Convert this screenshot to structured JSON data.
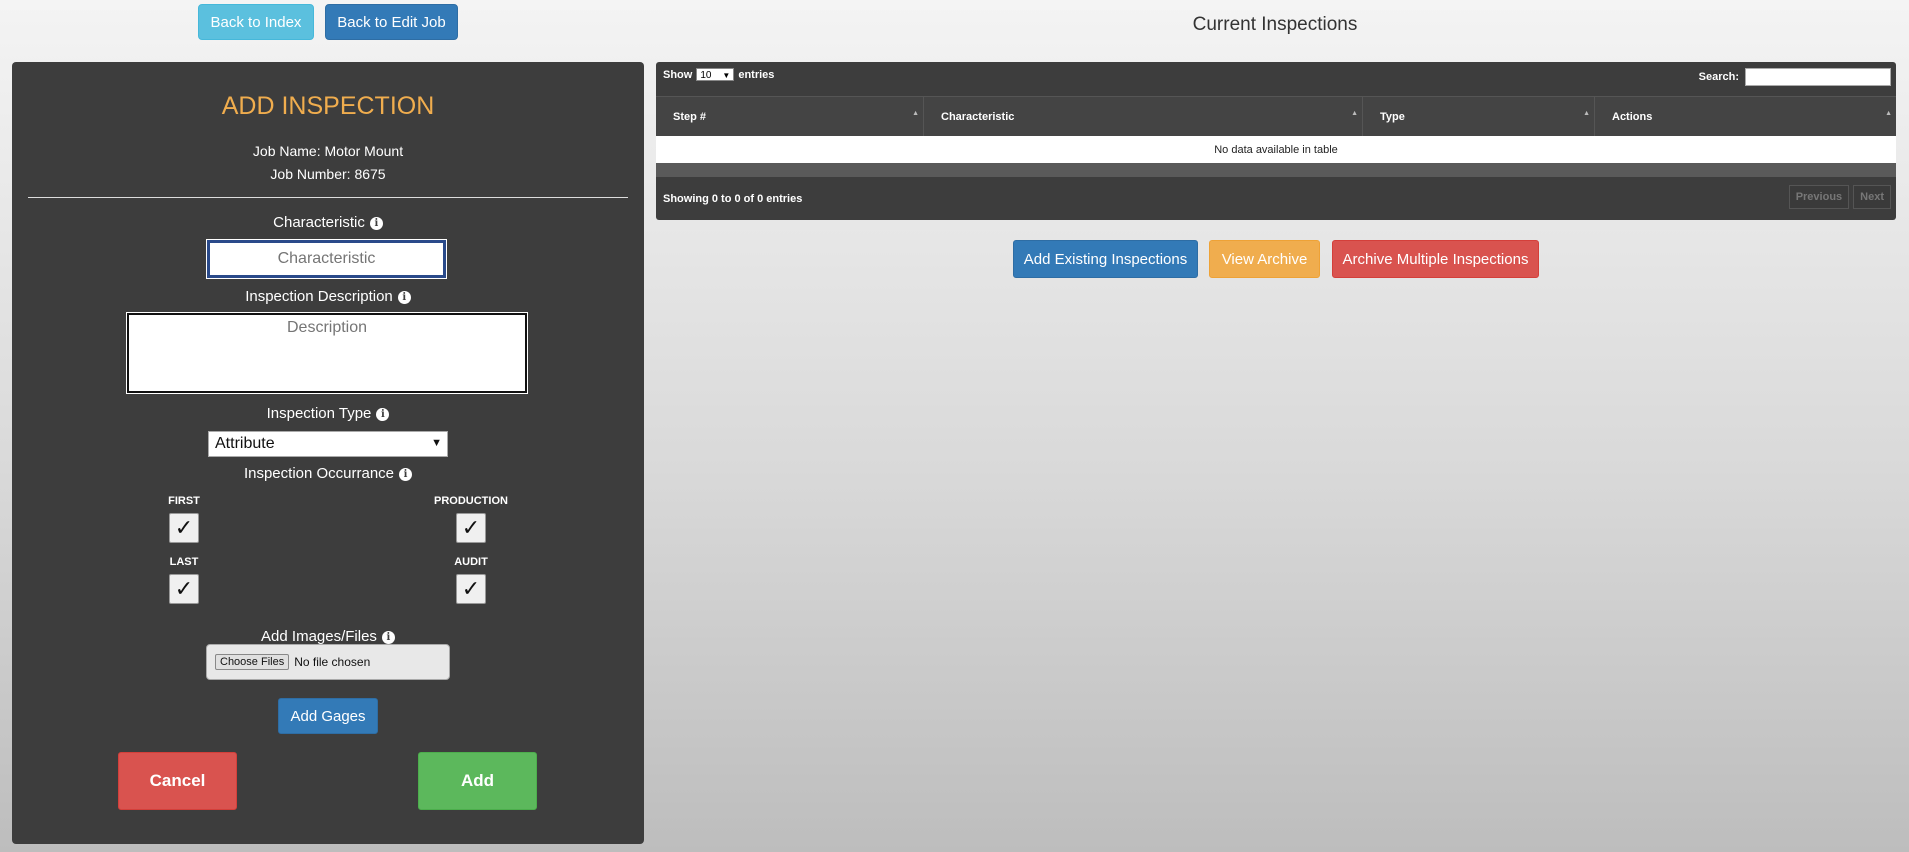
{
  "top_nav": {
    "back_index": "Back to Index",
    "back_edit_job": "Back to Edit Job"
  },
  "page_heading": "Current Inspections",
  "form": {
    "title": "ADD INSPECTION",
    "job_name": "Job Name: Motor Mount",
    "job_number": "Job Number: 8675",
    "characteristic_label": "Characteristic",
    "characteristic_placeholder": "Characteristic",
    "description_label": "Inspection Description",
    "description_placeholder": "Description",
    "type_label": "Inspection Type",
    "type_value": "Attribute",
    "occurrence_label": "Inspection Occurrance",
    "occurrences": [
      {
        "label": "FIRST",
        "checked": true
      },
      {
        "label": "PRODUCTION",
        "checked": true
      },
      {
        "label": "LAST",
        "checked": true
      },
      {
        "label": "AUDIT",
        "checked": true
      }
    ],
    "check_glyph": "✓",
    "files_label": "Add Images/Files",
    "choose_files": "Choose Files",
    "no_file": "No file chosen",
    "add_gages": "Add Gages",
    "cancel": "Cancel",
    "add": "Add"
  },
  "table": {
    "show": "Show",
    "length_value": "10",
    "entries": "entries",
    "search_label": "Search:",
    "columns": [
      "Step #",
      "Characteristic",
      "Type",
      "Actions"
    ],
    "empty_text": "No data available in table",
    "info": "Showing 0 to 0 of 0 entries",
    "previous": "Previous",
    "next": "Next"
  },
  "actions": {
    "add_existing": "Add Existing Inspections",
    "view_archive": "View Archive",
    "archive_multiple": "Archive Multiple Inspections"
  },
  "colors": {
    "panel_bg": "#3d3d3d",
    "title_orange": "#f0ad4e",
    "primary": "#337ab7",
    "info": "#5bc0de",
    "danger": "#d9534f",
    "success": "#5cb85c"
  },
  "icons": {
    "info": "info-circle-icon",
    "sort": "sort-icon",
    "dropdown": "chevron-down-icon"
  }
}
